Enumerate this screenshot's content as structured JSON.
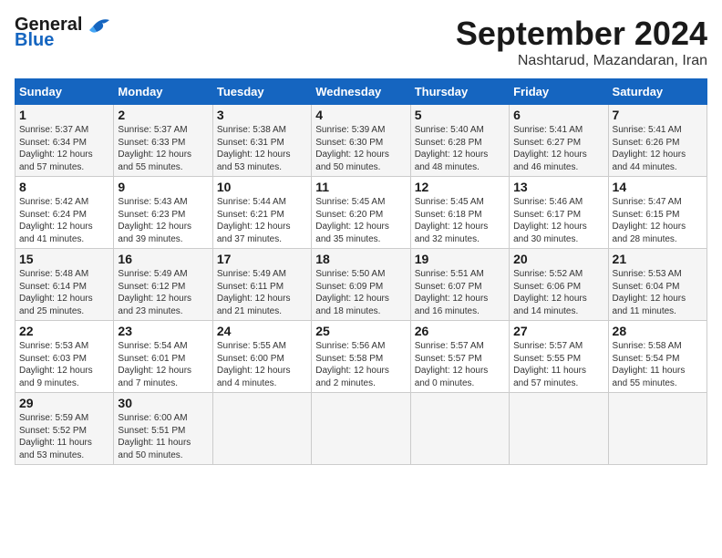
{
  "header": {
    "logo_general": "General",
    "logo_blue": "Blue",
    "month_title": "September 2024",
    "subtitle": "Nashtarud, Mazandaran, Iran"
  },
  "calendar": {
    "days_of_week": [
      "Sunday",
      "Monday",
      "Tuesday",
      "Wednesday",
      "Thursday",
      "Friday",
      "Saturday"
    ],
    "weeks": [
      [
        {
          "day": "",
          "info": ""
        },
        {
          "day": "2",
          "info": "Sunrise: 5:37 AM\nSunset: 6:33 PM\nDaylight: 12 hours\nand 55 minutes."
        },
        {
          "day": "3",
          "info": "Sunrise: 5:38 AM\nSunset: 6:31 PM\nDaylight: 12 hours\nand 53 minutes."
        },
        {
          "day": "4",
          "info": "Sunrise: 5:39 AM\nSunset: 6:30 PM\nDaylight: 12 hours\nand 50 minutes."
        },
        {
          "day": "5",
          "info": "Sunrise: 5:40 AM\nSunset: 6:28 PM\nDaylight: 12 hours\nand 48 minutes."
        },
        {
          "day": "6",
          "info": "Sunrise: 5:41 AM\nSunset: 6:27 PM\nDaylight: 12 hours\nand 46 minutes."
        },
        {
          "day": "7",
          "info": "Sunrise: 5:41 AM\nSunset: 6:26 PM\nDaylight: 12 hours\nand 44 minutes."
        }
      ],
      [
        {
          "day": "8",
          "info": "Sunrise: 5:42 AM\nSunset: 6:24 PM\nDaylight: 12 hours\nand 41 minutes."
        },
        {
          "day": "9",
          "info": "Sunrise: 5:43 AM\nSunset: 6:23 PM\nDaylight: 12 hours\nand 39 minutes."
        },
        {
          "day": "10",
          "info": "Sunrise: 5:44 AM\nSunset: 6:21 PM\nDaylight: 12 hours\nand 37 minutes."
        },
        {
          "day": "11",
          "info": "Sunrise: 5:45 AM\nSunset: 6:20 PM\nDaylight: 12 hours\nand 35 minutes."
        },
        {
          "day": "12",
          "info": "Sunrise: 5:45 AM\nSunset: 6:18 PM\nDaylight: 12 hours\nand 32 minutes."
        },
        {
          "day": "13",
          "info": "Sunrise: 5:46 AM\nSunset: 6:17 PM\nDaylight: 12 hours\nand 30 minutes."
        },
        {
          "day": "14",
          "info": "Sunrise: 5:47 AM\nSunset: 6:15 PM\nDaylight: 12 hours\nand 28 minutes."
        }
      ],
      [
        {
          "day": "15",
          "info": "Sunrise: 5:48 AM\nSunset: 6:14 PM\nDaylight: 12 hours\nand 25 minutes."
        },
        {
          "day": "16",
          "info": "Sunrise: 5:49 AM\nSunset: 6:12 PM\nDaylight: 12 hours\nand 23 minutes."
        },
        {
          "day": "17",
          "info": "Sunrise: 5:49 AM\nSunset: 6:11 PM\nDaylight: 12 hours\nand 21 minutes."
        },
        {
          "day": "18",
          "info": "Sunrise: 5:50 AM\nSunset: 6:09 PM\nDaylight: 12 hours\nand 18 minutes."
        },
        {
          "day": "19",
          "info": "Sunrise: 5:51 AM\nSunset: 6:07 PM\nDaylight: 12 hours\nand 16 minutes."
        },
        {
          "day": "20",
          "info": "Sunrise: 5:52 AM\nSunset: 6:06 PM\nDaylight: 12 hours\nand 14 minutes."
        },
        {
          "day": "21",
          "info": "Sunrise: 5:53 AM\nSunset: 6:04 PM\nDaylight: 12 hours\nand 11 minutes."
        }
      ],
      [
        {
          "day": "22",
          "info": "Sunrise: 5:53 AM\nSunset: 6:03 PM\nDaylight: 12 hours\nand 9 minutes."
        },
        {
          "day": "23",
          "info": "Sunrise: 5:54 AM\nSunset: 6:01 PM\nDaylight: 12 hours\nand 7 minutes."
        },
        {
          "day": "24",
          "info": "Sunrise: 5:55 AM\nSunset: 6:00 PM\nDaylight: 12 hours\nand 4 minutes."
        },
        {
          "day": "25",
          "info": "Sunrise: 5:56 AM\nSunset: 5:58 PM\nDaylight: 12 hours\nand 2 minutes."
        },
        {
          "day": "26",
          "info": "Sunrise: 5:57 AM\nSunset: 5:57 PM\nDaylight: 12 hours\nand 0 minutes."
        },
        {
          "day": "27",
          "info": "Sunrise: 5:57 AM\nSunset: 5:55 PM\nDaylight: 11 hours\nand 57 minutes."
        },
        {
          "day": "28",
          "info": "Sunrise: 5:58 AM\nSunset: 5:54 PM\nDaylight: 11 hours\nand 55 minutes."
        }
      ],
      [
        {
          "day": "29",
          "info": "Sunrise: 5:59 AM\nSunset: 5:52 PM\nDaylight: 11 hours\nand 53 minutes."
        },
        {
          "day": "30",
          "info": "Sunrise: 6:00 AM\nSunset: 5:51 PM\nDaylight: 11 hours\nand 50 minutes."
        },
        {
          "day": "",
          "info": ""
        },
        {
          "day": "",
          "info": ""
        },
        {
          "day": "",
          "info": ""
        },
        {
          "day": "",
          "info": ""
        },
        {
          "day": "",
          "info": ""
        }
      ]
    ],
    "first_week_day1": {
      "day": "1",
      "info": "Sunrise: 5:37 AM\nSunset: 6:34 PM\nDaylight: 12 hours\nand 57 minutes."
    }
  }
}
